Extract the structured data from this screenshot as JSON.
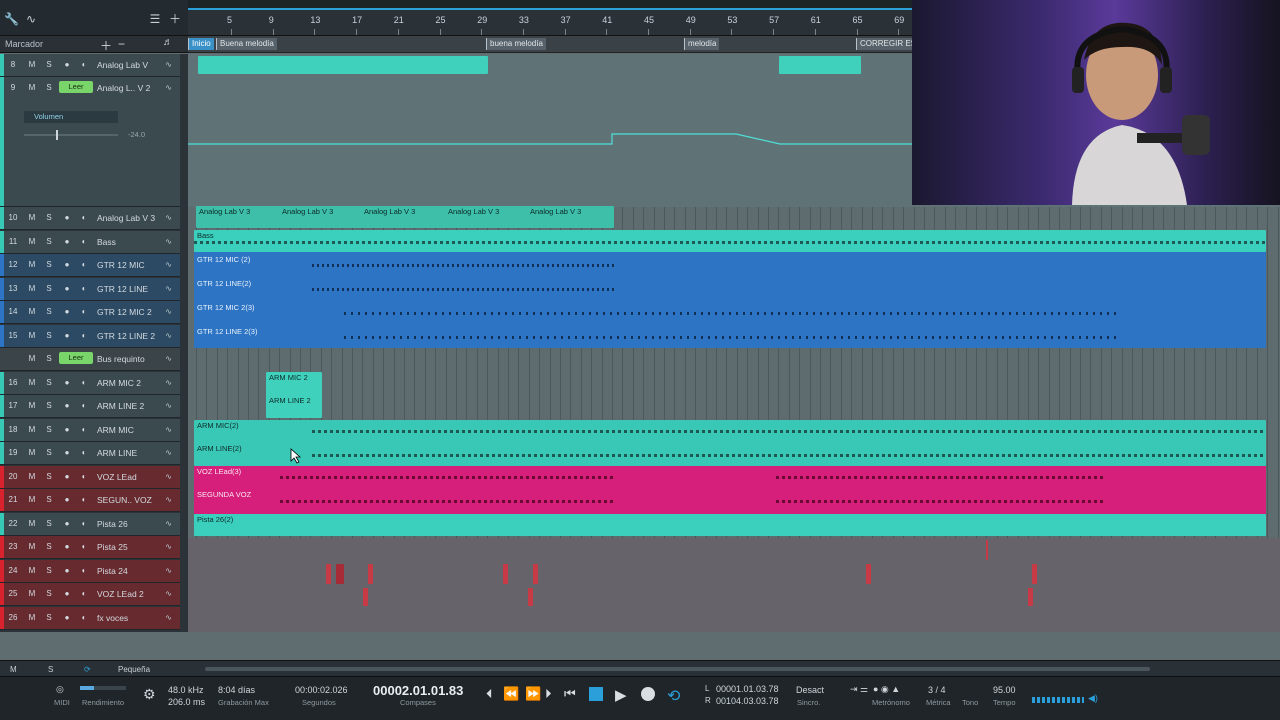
{
  "toolbar": {
    "marker_label": "Marcador"
  },
  "ruler": {
    "ticks": [
      "5",
      "9",
      "13",
      "17",
      "21",
      "25",
      "29",
      "33",
      "37",
      "41",
      "45",
      "49",
      "53",
      "57",
      "61",
      "65",
      "69"
    ]
  },
  "markers": [
    {
      "label": "Inicio"
    },
    {
      "label": "Buena melodía"
    },
    {
      "label": "buena melodía"
    },
    {
      "label": "melodía"
    },
    {
      "label": "CORREGIR EST"
    }
  ],
  "tracks": [
    {
      "num": "8",
      "name": "Analog Lab V",
      "color": "teal"
    },
    {
      "num": "9",
      "name": "Analog L.. V 2",
      "color": "teal",
      "read": "Leer",
      "param": "Volumen",
      "value": "-24.0"
    },
    {
      "num": "10",
      "name": "Analog Lab V 3",
      "color": "teal"
    },
    {
      "num": "11",
      "name": "Bass",
      "color": "teal"
    },
    {
      "num": "12",
      "name": "GTR 12 MIC",
      "color": "blue"
    },
    {
      "num": "13",
      "name": "GTR 12 LINE",
      "color": "blue"
    },
    {
      "num": "14",
      "name": "GTR 12 MIC 2",
      "color": "blue"
    },
    {
      "num": "15",
      "name": "GTR 12 LINE 2",
      "color": "blue"
    },
    {
      "num": "",
      "name": "Bus requinto",
      "color": "grey",
      "read": "Leer"
    },
    {
      "num": "16",
      "name": "ARM MIC 2",
      "color": "teal"
    },
    {
      "num": "17",
      "name": "ARM LINE 2",
      "color": "teal"
    },
    {
      "num": "18",
      "name": "ARM MIC",
      "color": "teal"
    },
    {
      "num": "19",
      "name": "ARM LINE",
      "color": "teal"
    },
    {
      "num": "20",
      "name": "VOZ LEad",
      "color": "red"
    },
    {
      "num": "21",
      "name": "SEGUN.. VOZ",
      "color": "red"
    },
    {
      "num": "22",
      "name": "Pista 26",
      "color": "teal"
    },
    {
      "num": "23",
      "name": "Pista 25",
      "color": "red"
    },
    {
      "num": "24",
      "name": "Pista 24",
      "color": "red"
    },
    {
      "num": "25",
      "name": "VOZ LEad 2",
      "color": "red"
    },
    {
      "num": "26",
      "name": "fx voces",
      "color": "red"
    }
  ],
  "track_buttons": {
    "mute": "M",
    "solo": "S"
  },
  "clips": {
    "analog3": "Analog Lab V 3",
    "bass": "Bass",
    "gtr_mic": "GTR 12 MIC (2)",
    "gtr_line": "GTR 12 LINE(2)",
    "gtr_mic2": "GTR 12 MIC  2(3)",
    "gtr_line2": "GTR 12 LINE 2(3)",
    "arm_mic2": "ARM MIC 2",
    "arm_line2": "ARM LINE 2",
    "arm_mic": "ARM MIC(2)",
    "arm_line": "ARM LINE(2)",
    "voz_lead": "VOZ LEad(3)",
    "segunda": "SEGUNDA VOZ",
    "pista26": "Pista 26(2)"
  },
  "bottom": {
    "m_label": "M",
    "s_label": "S",
    "zoom_label": "Pequeña"
  },
  "transport": {
    "midi": "MIDI",
    "rendimiento": "Rendimiento",
    "sample_rate": "48.0 kHz",
    "latency": "206.0 ms",
    "days": "8:04 días",
    "grab_max": "Grabación Max",
    "seconds": "00:00:02.026",
    "seconds_label": "Segundos",
    "position": "00002.01.01.83",
    "position_label": "Compases",
    "loop_l": "00001.01.03.78",
    "loop_r": "00104.03.03.78",
    "l_label": "L",
    "r_label": "R",
    "sync": "Desact",
    "sync_label": "Sincro.",
    "metronome_label": "Metrónomo",
    "meter": "3 / 4",
    "meter_label": "Métrica",
    "tone_label": "Tono",
    "tempo": "95.00",
    "tempo_label": "Tempo"
  },
  "colors": {
    "teal": "#37c9b6",
    "blue": "#2d74c4",
    "pink": "#d51f7a",
    "accent": "#2b9fd9"
  }
}
